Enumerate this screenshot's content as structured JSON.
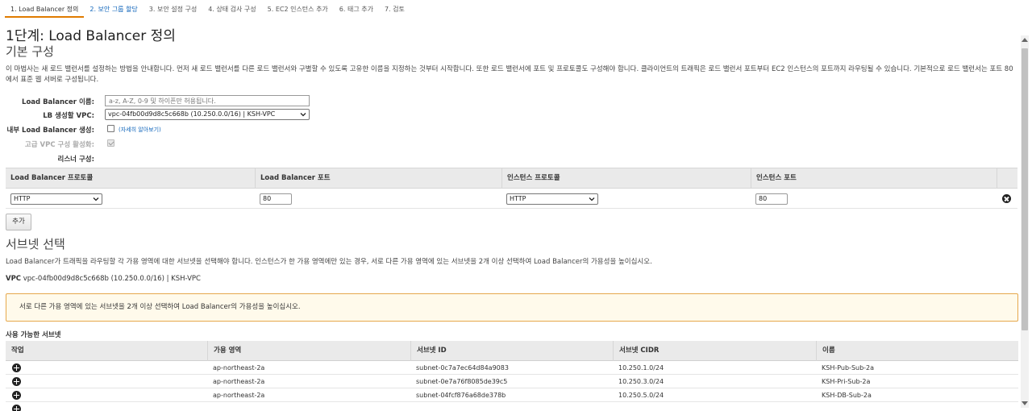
{
  "tabs": [
    {
      "label": "1. Load Balancer 정의"
    },
    {
      "label": "2. 보안 그룹 할당"
    },
    {
      "label": "3. 보안 설정 구성"
    },
    {
      "label": "4. 상태 검사 구성"
    },
    {
      "label": "5. EC2 인스턴스 추가"
    },
    {
      "label": "6. 태그 추가"
    },
    {
      "label": "7. 검토"
    }
  ],
  "page_title": "1단계: Load Balancer 정의",
  "basic": {
    "title": "기본 구성",
    "description": "이 마법사는 새 로드 밸런서를 설정하는 방법을 안내합니다. 먼저 새 로드 밸런서를 다른 로드 밸런서와 구별할 수 있도록 고유한 이름을 지정하는 것부터 시작합니다. 또한 로드 밸런서에 포트 및 프로토콜도 구성해야 합니다. 클라이언트의 트래픽은 로드 밸런서 포트부터 EC2 인스턴스의 포트까지 라우팅될 수 있습니다. 기본적으로 로드 밸런서는 포트 80에서 표준 웹 서버로 구성됩니다.",
    "name_label": "Load Balancer 이름:",
    "name_placeholder": "a-z, A-Z, 0-9 및 하이픈만 허용됩니다.",
    "vpc_label": "LB 생성할 VPC:",
    "vpc_value": "vpc-04fb00d9d8c5c668b (10.250.0.0/16) | KSH-VPC",
    "internal_label": "내부 Load Balancer 생성:",
    "learn_more": "(자세히 알아보기)",
    "advanced_label": "고급 VPC 구성 활성화:",
    "listener_label": "리스너 구성:"
  },
  "listeners": {
    "headers": [
      "Load Balancer 프로토콜",
      "Load Balancer 포트",
      "인스턴스 프로토콜",
      "인스턴스 포트"
    ],
    "row": {
      "lb_protocol": "HTTP",
      "lb_port": "80",
      "instance_protocol": "HTTP",
      "instance_port": "80"
    },
    "add_button": "추가"
  },
  "subnets": {
    "title": "서브넷 선택",
    "description": "Load Balancer가 트래픽을 라우팅할 각 가용 영역에 대한 서브넷을 선택해야 합니다. 인스턴스가 한 가용 영역에만 있는 경우, 서로 다른 가용 영역에 있는 서브넷을 2개 이상 선택하여 Load Balancer의 가용성을 높이십시오.",
    "vpc_prefix": "VPC",
    "vpc_value": "vpc-04fb00d9d8c5c668b (10.250.0.0/16) | KSH-VPC",
    "warning": "서로 다른 가용 영역에 있는 서브넷을 2개 이상 선택하여 Load Balancer의 가용성을 높이십시오.",
    "available_label": "사용 가능한 서브넷",
    "headers": [
      "작업",
      "가용 영역",
      "서브넷 ID",
      "서브넷 CIDR",
      "이름"
    ],
    "rows": [
      {
        "az": "ap-northeast-2a",
        "id": "subnet-0c7a7ec64d84a9083",
        "cidr": "10.250.1.0/24",
        "name": "KSH-Pub-Sub-2a"
      },
      {
        "az": "ap-northeast-2a",
        "id": "subnet-0e7a76f8085de39c5",
        "cidr": "10.250.3.0/24",
        "name": "KSH-Pri-Sub-2a"
      },
      {
        "az": "ap-northeast-2a",
        "id": "subnet-04fcf876a68de378b",
        "cidr": "10.250.5.0/24",
        "name": "KSH-DB-Sub-2a"
      }
    ]
  }
}
